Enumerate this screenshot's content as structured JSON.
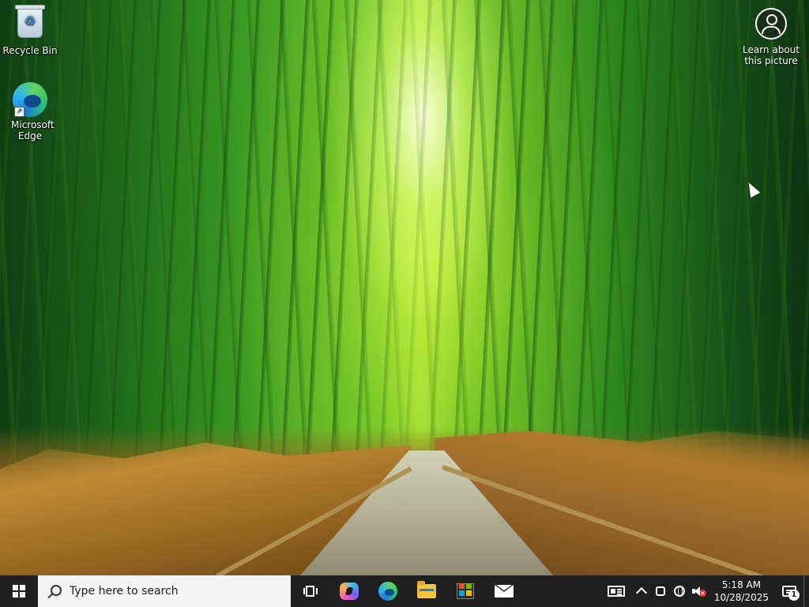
{
  "desktop": {
    "icons": [
      {
        "label": "Recycle Bin",
        "icon": "recycle-bin-icon"
      },
      {
        "label": "Microsoft Edge",
        "icon": "edge-icon"
      }
    ],
    "learn_label": "Learn about this picture",
    "wallpaper": "bamboo forest path"
  },
  "taskbar": {
    "search_placeholder": "Type here to search",
    "pinned": [
      {
        "name": "Task View",
        "icon": "task-view-icon"
      },
      {
        "name": "Copilot",
        "icon": "copilot-icon"
      },
      {
        "name": "Microsoft Edge",
        "icon": "edge-icon"
      },
      {
        "name": "File Explorer",
        "icon": "folder-icon"
      },
      {
        "name": "Microsoft Store",
        "icon": "store-icon"
      },
      {
        "name": "Mail",
        "icon": "mail-icon"
      }
    ],
    "tray": {
      "time": "5:18 AM",
      "date": "10/28/2025",
      "notification_count": "1",
      "volume_state": "muted"
    }
  },
  "colors": {
    "taskbar_bg": "#1f1f1f",
    "search_bg": "#f3f3f3"
  }
}
